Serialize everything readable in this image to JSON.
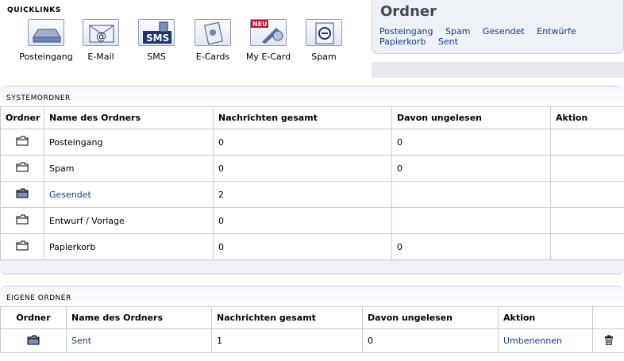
{
  "quicklinks": {
    "title": "QUICKLINKS",
    "items": [
      {
        "label": "Posteingang",
        "icon": "inbox-icon"
      },
      {
        "label": "E-Mail",
        "icon": "email-icon"
      },
      {
        "label": "SMS",
        "icon": "sms-icon",
        "icon_text": "SMS"
      },
      {
        "label": "E-Cards",
        "icon": "ecard-icon"
      },
      {
        "label": "My E-Card",
        "icon": "my-ecard-icon",
        "badge": "NEU"
      },
      {
        "label": "Spam",
        "icon": "spam-icon"
      }
    ]
  },
  "ordner_panel": {
    "title": "Ordner",
    "links": [
      "Posteingang",
      "Spam",
      "Gesendet",
      "Entwürfe",
      "Papierkorb",
      "Sent"
    ]
  },
  "system": {
    "title": "SYSTEMORDNER",
    "headers": [
      "Ordner",
      "Name des Ordners",
      "Nachrichten gesamt",
      "Davon ungelesen",
      "Aktion"
    ],
    "rows": [
      {
        "name": "Posteingang",
        "total": "0",
        "unread": "0",
        "link": false,
        "icon": "folder-icon"
      },
      {
        "name": "Spam",
        "total": "0",
        "unread": "0",
        "link": false,
        "icon": "folder-icon"
      },
      {
        "name": "Gesendet",
        "total": "2",
        "unread": "",
        "link": true,
        "icon": "folder-filled-icon"
      },
      {
        "name": "Entwurf / Vorlage",
        "total": "0",
        "unread": "",
        "link": false,
        "icon": "folder-icon"
      },
      {
        "name": "Papierkorb",
        "total": "0",
        "unread": "0",
        "link": false,
        "icon": "folder-icon"
      }
    ]
  },
  "own": {
    "title": "EIGENE ORDNER",
    "headers": [
      "Ordner",
      "Name des Ordners",
      "Nachrichten gesamt",
      "Davon ungelesen",
      "Aktion",
      ""
    ],
    "rows": [
      {
        "name": "Sent",
        "total": "1",
        "unread": "0",
        "action": "Umbenennen",
        "icon": "folder-filled-icon"
      }
    ]
  },
  "colors": {
    "link": "#0d3c8f",
    "panel": "#eef1f6",
    "border": "#c9ccd2"
  }
}
